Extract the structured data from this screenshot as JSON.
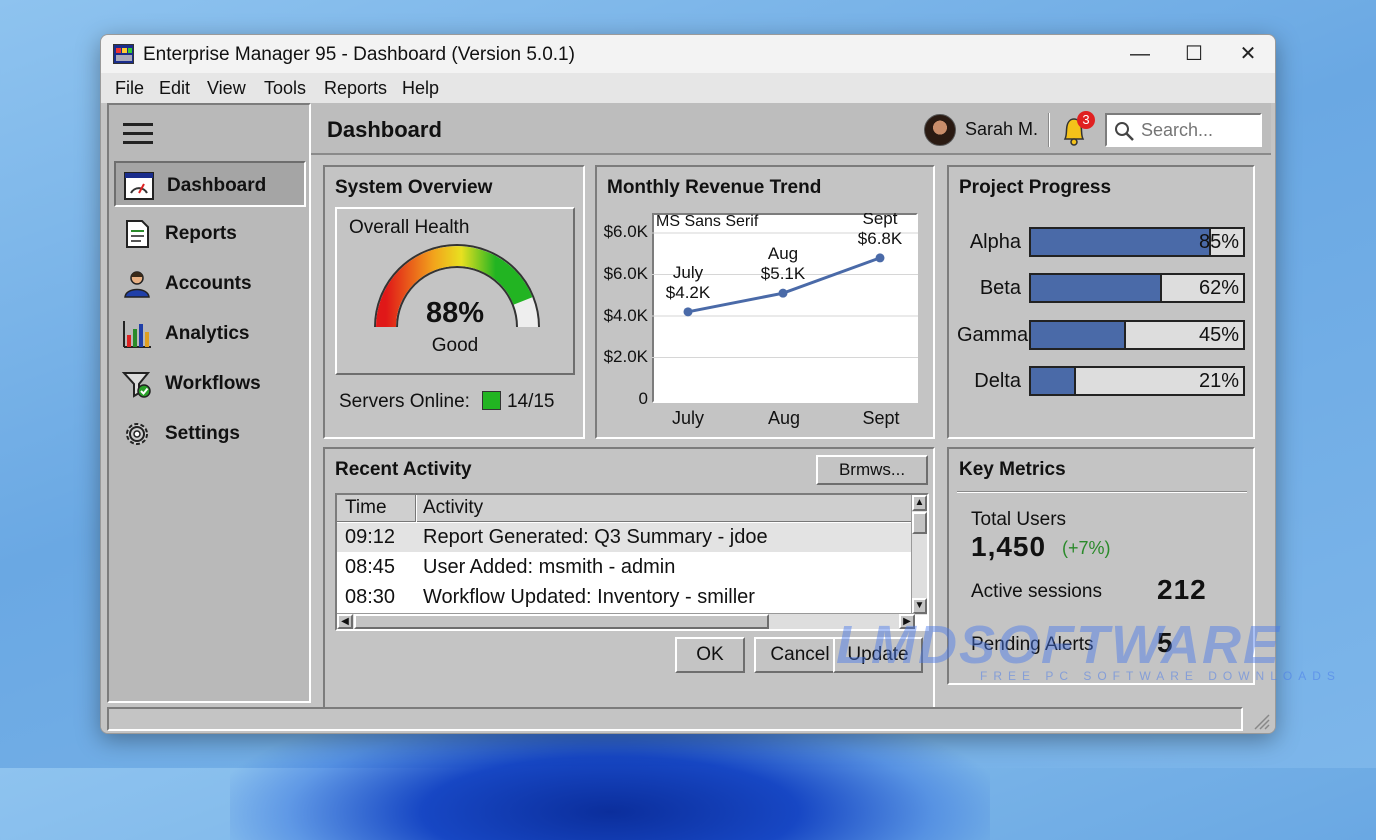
{
  "window": {
    "title": "Enterprise Manager 95 - Dashboard (Version 5.0.1)",
    "controls": {
      "minimize": "—",
      "maximize": "☐",
      "close": "✕"
    }
  },
  "menubar": [
    "File",
    "Edit",
    "View",
    "Tools",
    "Reports",
    "Help"
  ],
  "sidebar": {
    "items": [
      {
        "label": "Dashboard",
        "icon": "dashboard-icon",
        "active": true
      },
      {
        "label": "Reports",
        "icon": "report-icon",
        "active": false
      },
      {
        "label": "Accounts",
        "icon": "user-icon",
        "active": false
      },
      {
        "label": "Analytics",
        "icon": "bar-chart-icon",
        "active": false
      },
      {
        "label": "Workflows",
        "icon": "workflow-icon",
        "active": false
      },
      {
        "label": "Settings",
        "icon": "gear-icon",
        "active": false
      }
    ]
  },
  "header": {
    "title": "Dashboard",
    "user": "Sarah M.",
    "notification_count": "3",
    "search_placeholder": "Search..."
  },
  "system_overview": {
    "title": "System Overview",
    "gauge_label": "Overall Health",
    "health_value": "88%",
    "health_fraction": 0.88,
    "health_status": "Good",
    "servers_label": "Servers Online:",
    "servers_value": "14/15"
  },
  "revenue_chart": {
    "title": "Monthly Revenue Trend",
    "overlay_text": "MS Sans Serif"
  },
  "chart_data": {
    "type": "line",
    "title": "Monthly Revenue Trend",
    "categories": [
      "July",
      "Aug",
      "Sept"
    ],
    "values": [
      4.2,
      5.1,
      6.8
    ],
    "point_labels": [
      "July\n$4.2K",
      "Aug\n$5.1K",
      "Sept\n$6.8K"
    ],
    "yticks": [
      "0",
      "$2.0K",
      "$4.0K",
      "$6.0K",
      "$6.0K"
    ],
    "ylim": [
      0,
      8
    ],
    "grid": true,
    "series_color": "#4a6aa8"
  },
  "project_progress": {
    "title": "Project Progress",
    "projects": [
      {
        "name": "Alpha",
        "pct": "85%",
        "value": 0.85
      },
      {
        "name": "Beta",
        "pct": "62%",
        "value": 0.62
      },
      {
        "name": "Gamma",
        "pct": "45%",
        "value": 0.45
      },
      {
        "name": "Delta",
        "pct": "21%",
        "value": 0.21
      }
    ],
    "bar_color": "#4a6aa8"
  },
  "recent_activity": {
    "title": "Recent Activity",
    "browse_button": "Brmws...",
    "columns": [
      "Time",
      "Activity"
    ],
    "rows": [
      {
        "time": "09:12",
        "activity": "Report Generated: Q3 Summary - jdoe"
      },
      {
        "time": "08:45",
        "activity": "User Added: msmith - admin"
      },
      {
        "time": "08:30",
        "activity": "Workflow Updated: Inventory - smiller"
      }
    ],
    "buttons": {
      "ok": "OK",
      "cancel": "Cancel",
      "update": "Update"
    }
  },
  "key_metrics": {
    "title": "Key Metrics",
    "total_users_label": "Total Users",
    "total_users_value": "1,450",
    "total_users_change": "(+7%)",
    "active_sessions_label": "Active sessions",
    "active_sessions_value": "212",
    "pending_alerts_label": "Pending Alerts",
    "pending_alerts_value": "5"
  },
  "watermark": {
    "main": "LMDSOFTWARE",
    "sub": "FREE PC SOFTWARE DOWNLOADS"
  }
}
